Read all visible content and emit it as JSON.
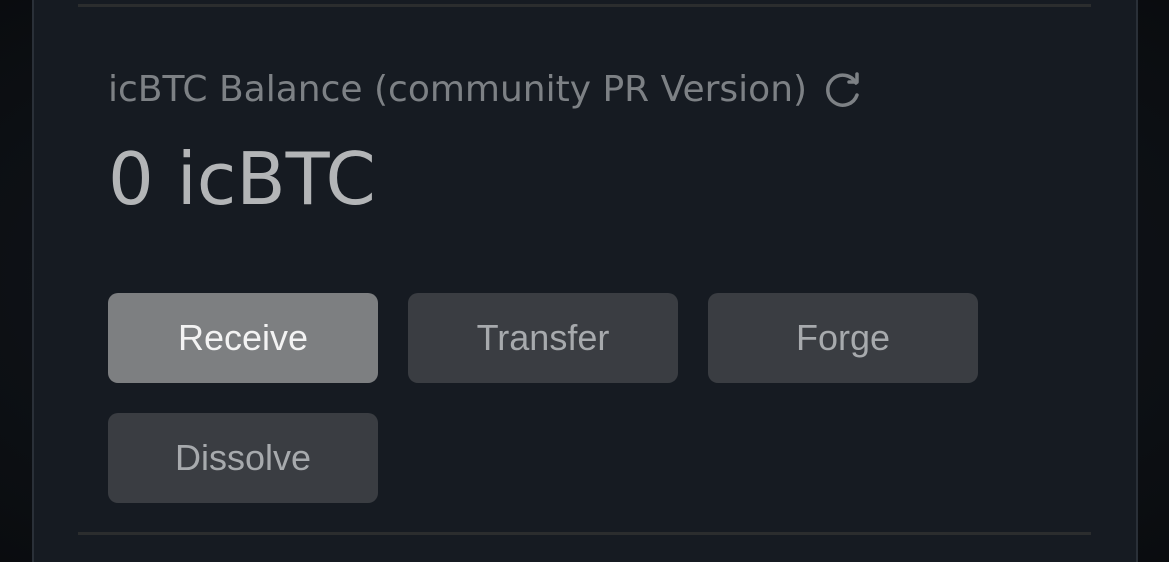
{
  "balance": {
    "title": "icBTC Balance (community PR Version)",
    "amount": "0 icBTC",
    "refresh_icon": "refresh-icon"
  },
  "actions": {
    "receive": "Receive",
    "transfer": "Transfer",
    "forge": "Forge",
    "dissolve": "Dissolve"
  },
  "colors": {
    "background": "#161b22",
    "primary_button": "#7d7f81",
    "secondary_button": "#3a3d42",
    "title_text": "#7d8185",
    "amount_text": "#b3b5b7"
  }
}
